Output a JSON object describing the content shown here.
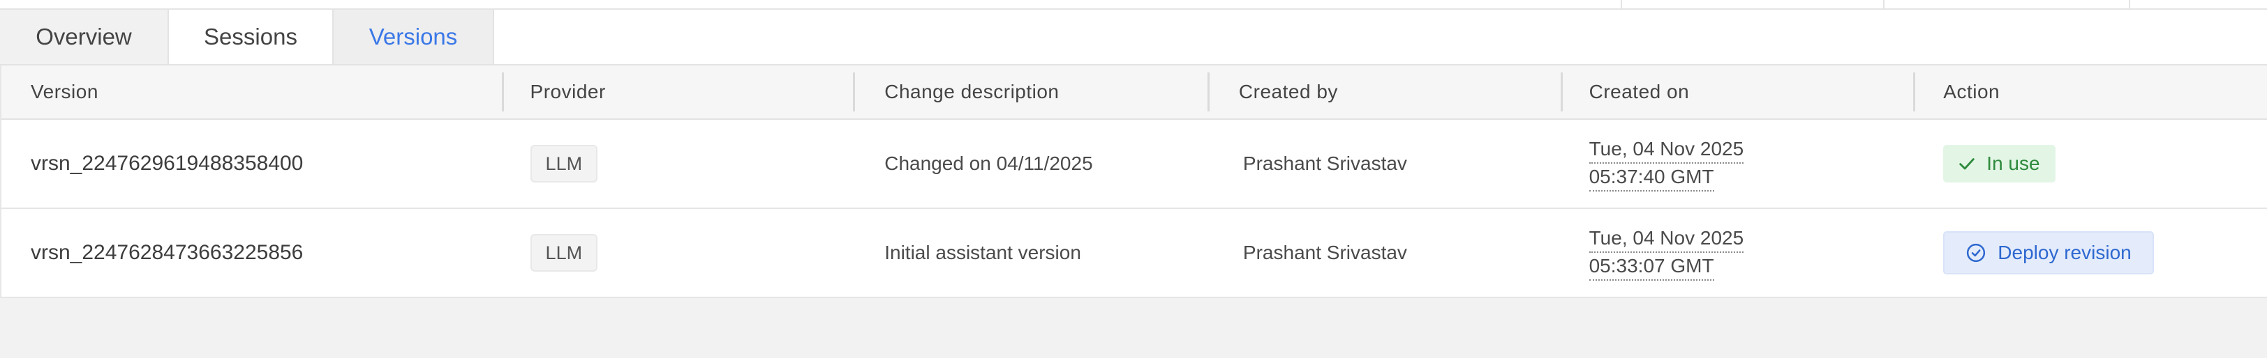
{
  "tabs": [
    {
      "label": "Overview"
    },
    {
      "label": "Sessions"
    },
    {
      "label": "Versions"
    }
  ],
  "table": {
    "headers": {
      "version": "Version",
      "provider": "Provider",
      "change": "Change description",
      "created_by": "Created by",
      "created_on": "Created on",
      "action": "Action"
    },
    "rows": [
      {
        "version": "vrsn_2247629619488358400",
        "provider": "LLM",
        "change": "Changed on 04/11/2025",
        "created_by": "Prashant Srivastav",
        "created_on_date": "Tue, 04 Nov 2025",
        "created_on_time": "05:37:40 GMT",
        "action": "In use"
      },
      {
        "version": "vrsn_2247628473663225856",
        "provider": "LLM",
        "change": "Initial assistant version",
        "created_by": "Prashant Srivastav",
        "created_on_date": "Tue, 04 Nov 2025",
        "created_on_time": "05:33:07 GMT",
        "action": "Deploy revision"
      }
    ]
  },
  "colors": {
    "accent": "#3b78e7",
    "in_use_bg": "#e3f6e6",
    "in_use_text": "#2e8a3c",
    "deploy_bg": "#e4ecfb",
    "deploy_text": "#2e68d0"
  },
  "icons": {
    "in_use": "check-icon",
    "deploy": "circle-check-icon"
  }
}
